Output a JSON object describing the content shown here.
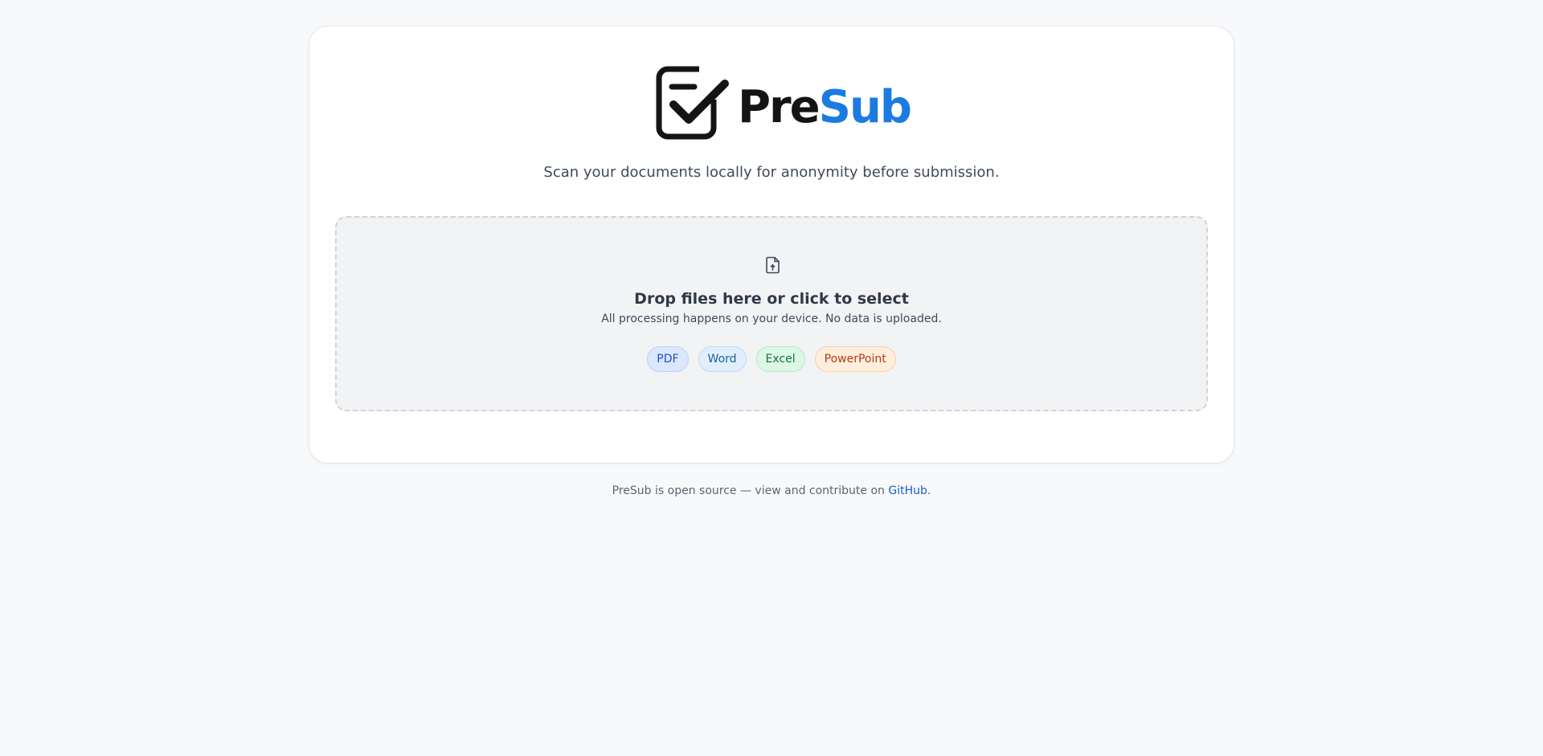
{
  "brand": {
    "name_part1": "Pre",
    "name_part2": "Sub",
    "logo_icon": "checkbox-check-icon",
    "colors": {
      "dark": "#141414",
      "accent": "#1c7be0"
    }
  },
  "tagline": "Scan your documents locally for anonymity before submission.",
  "dropzone": {
    "icon": "file-upload-icon",
    "title": "Drop files here or click to select",
    "subtitle": "All processing happens on your device. No data is uploaded.",
    "formats": [
      "PDF",
      "Word",
      "Excel",
      "PowerPoint"
    ]
  },
  "footer": {
    "text": "PreSub is open source — view and contribute on ",
    "link_label": "GitHub",
    "suffix": "."
  }
}
